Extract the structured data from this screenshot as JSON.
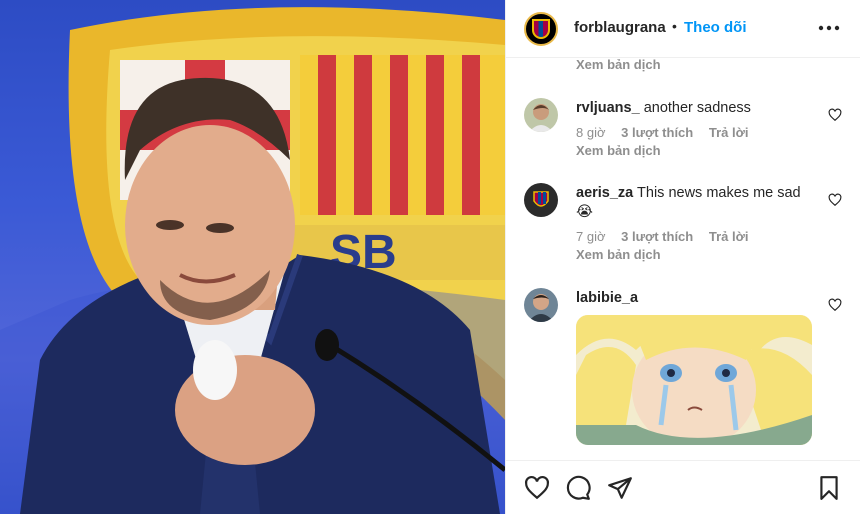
{
  "post": {
    "account": "forblaugrana",
    "separator": "•",
    "follow_label": "Theo dõi",
    "more_label": "•••",
    "avatar_text": "FCB"
  },
  "media": {
    "image_alt": "Photo of a tearful player in a navy suit at a press conference in front of a blaugrana crest",
    "crest_letters": "SB"
  },
  "comments": {
    "top_see_translation": "Xem bản dịch",
    "items": [
      {
        "username": "rvljuans_",
        "text": "another sadness",
        "time": "8 giờ",
        "likes": "3 lượt thích",
        "reply": "Trả lời",
        "see_translation": "Xem bản dịch"
      },
      {
        "username": "aeris_za",
        "text": "This news makes me sad",
        "emoji": "😭",
        "time": "7 giờ",
        "likes": "3 lượt thích",
        "reply": "Trả lời",
        "see_translation": "Xem bản dịch"
      },
      {
        "username": "labibie_a",
        "text": "",
        "gif_alt": "Anime character crying"
      }
    ]
  },
  "actions": {
    "like": "heart-icon",
    "comment": "comment-icon",
    "share": "share-icon",
    "save": "bookmark-icon"
  },
  "colors": {
    "follow": "#0095f6",
    "muted": "#8e8e8e",
    "text": "#262626"
  }
}
